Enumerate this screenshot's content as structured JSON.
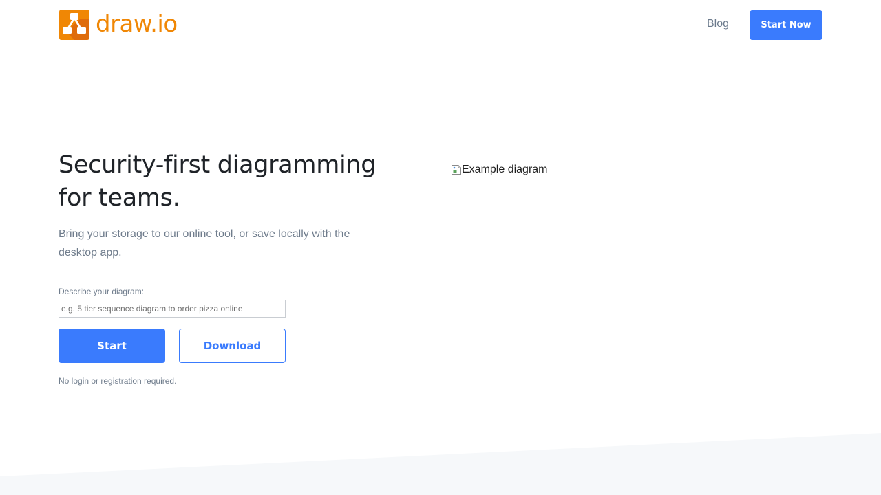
{
  "header": {
    "logo_text": "draw.io",
    "logo_icon": "drawio-logo-icon",
    "nav_blog_label": "Blog",
    "start_now_label": "Start Now"
  },
  "hero": {
    "title": "Security-first diagramming for teams.",
    "subtitle": "Bring your storage to our online tool, or save locally with the desktop app.",
    "describe_label": "Describe your diagram:",
    "describe_placeholder": "e.g. 5 tier sequence diagram to order pizza online",
    "start_label": "Start",
    "download_label": "Download",
    "no_login_note": "No login or registration required."
  },
  "example_image": {
    "alt": "Example diagram",
    "icon": "broken-image-icon"
  },
  "colors": {
    "brand_orange": "#f08705",
    "accent_blue": "#3a7bfd",
    "muted_text": "#6f7c8c",
    "band_background": "#f6f8fa"
  }
}
